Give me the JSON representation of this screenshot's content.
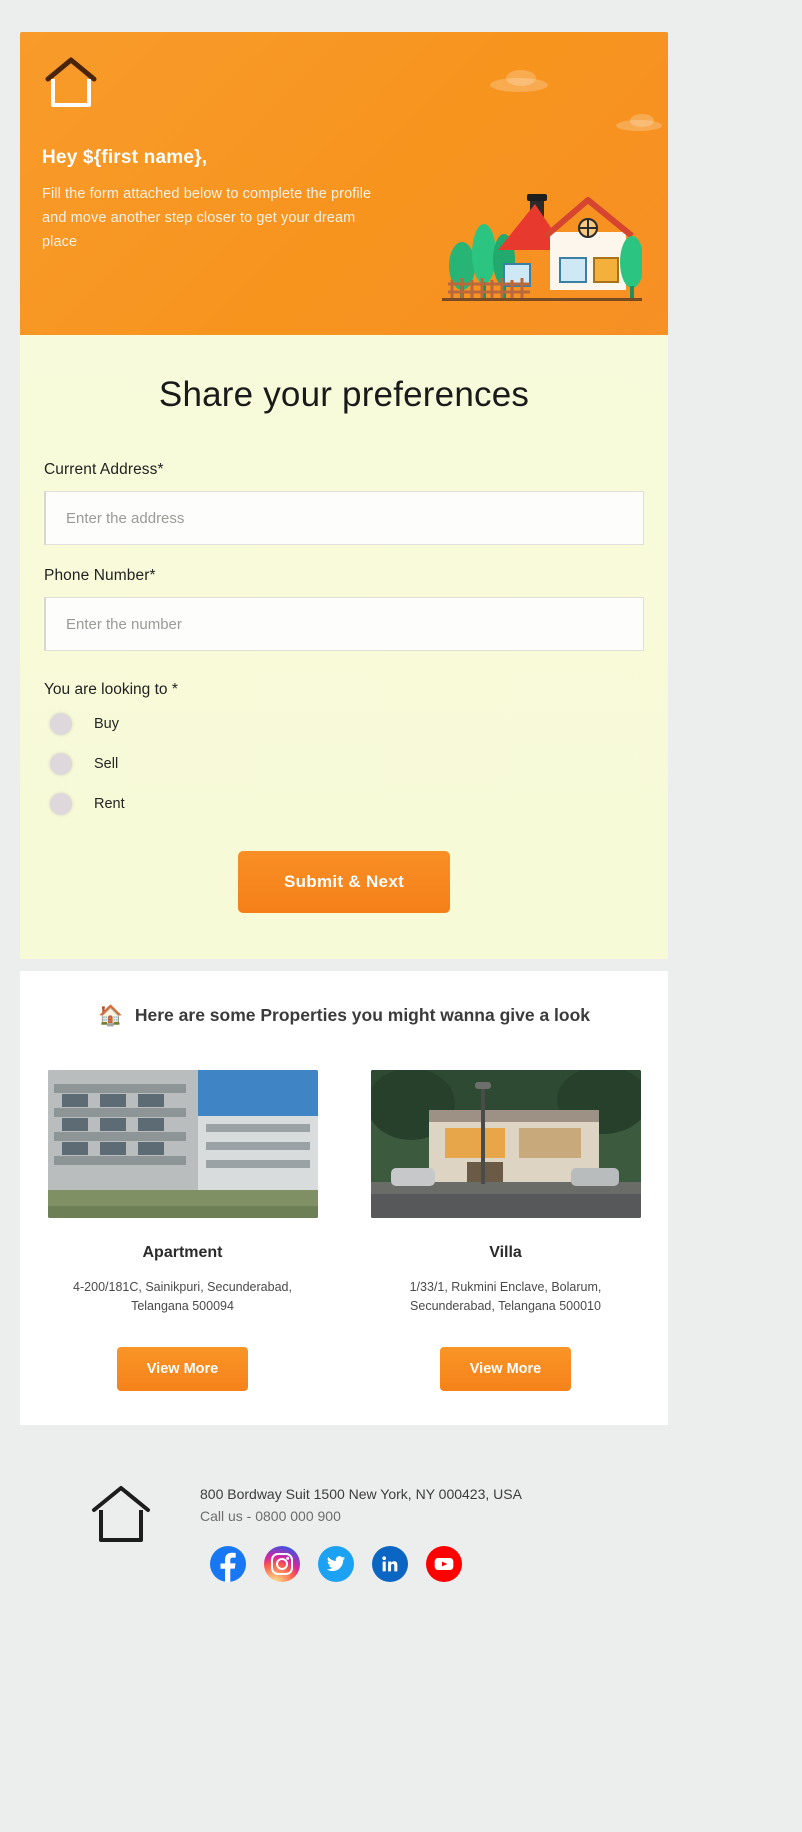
{
  "hero": {
    "logo_icon": "house-outline-logo",
    "greeting": "Hey ${first name},",
    "body": "Fill the form attached below to complete the profile and move another step closer to get your dream place",
    "illustration_icon": "house-illustration",
    "bg_color": "#f7941e"
  },
  "form": {
    "title": "Share your preferences",
    "address": {
      "label": "Current Address*",
      "placeholder": "Enter the address",
      "value": ""
    },
    "phone": {
      "label": "Phone Number*",
      "placeholder": "Enter the number",
      "value": ""
    },
    "looking_to": {
      "label": "You are looking to *",
      "options": [
        {
          "label": "Buy",
          "selected": false
        },
        {
          "label": "Sell",
          "selected": false
        },
        {
          "label": "Rent",
          "selected": false
        }
      ]
    },
    "submit_label": "Submit & Next",
    "bg_color": "#f7fbd9",
    "accent_color": "#f7871f"
  },
  "properties": {
    "heading_icon": "house-emoji",
    "heading": "Here are some Properties you might wanna give a look",
    "items": [
      {
        "photo_icon": "apartment-building-photo",
        "name": "Apartment",
        "address_line1": "4-200/181C, Sainikpuri, Secunderabad,",
        "address_line2": "Telangana 500094",
        "button_label": "View More"
      },
      {
        "photo_icon": "villa-house-photo",
        "name": "Villa",
        "address_line1": "1/33/1, Rukmini Enclave, Bolarum,",
        "address_line2": "Secunderabad, Telangana 500010",
        "button_label": "View More"
      }
    ]
  },
  "footer": {
    "logo_icon": "house-outline-logo",
    "address": "800 Bordway Suit 1500 New York, NY 000423, USA",
    "call": "Call us - 0800 000 900",
    "socials": [
      {
        "name": "facebook",
        "label": "f"
      },
      {
        "name": "instagram",
        "label": ""
      },
      {
        "name": "twitter",
        "label": ""
      },
      {
        "name": "linkedin",
        "label": "in"
      },
      {
        "name": "youtube",
        "label": ""
      }
    ]
  }
}
